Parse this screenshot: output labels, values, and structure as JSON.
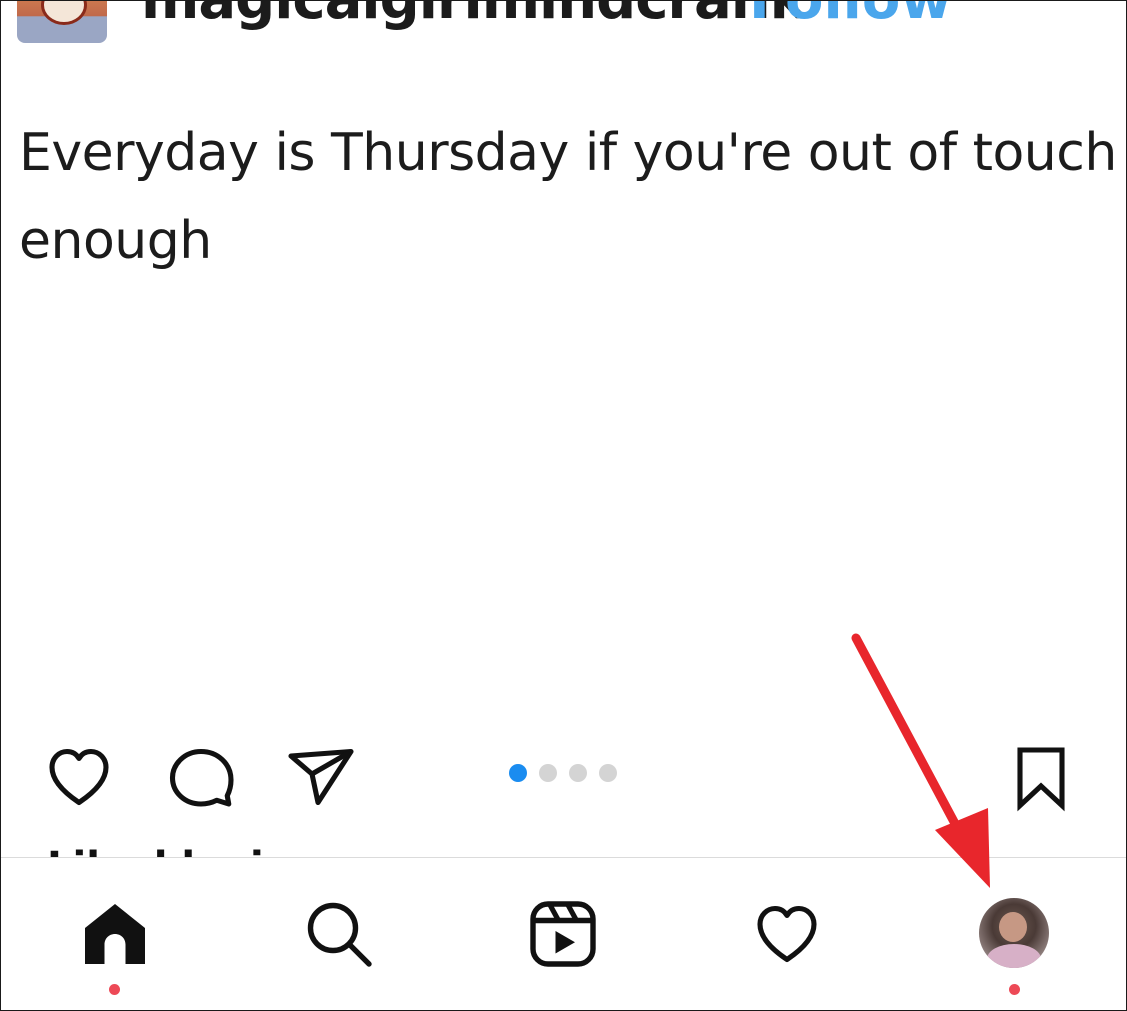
{
  "post": {
    "username": "magicalgirlmindcrank",
    "follow_label": "Follow",
    "text": "Everyday is Thursday if you're out of touch enough"
  },
  "actions": {
    "icons": [
      "heart-icon",
      "comment-icon",
      "share-icon",
      "bookmark-icon"
    ],
    "carousel": {
      "total": 4,
      "active_index": 0,
      "active_color": "#1a8cf0",
      "inactive_color": "#d4d4d4"
    }
  },
  "liked_by": "Liked by j",
  "bottom_nav": {
    "items": [
      "home-icon",
      "search-icon",
      "reels-icon",
      "activity-heart-icon",
      "profile-avatar"
    ],
    "notification_color": "#ed4956"
  },
  "annotation": {
    "color": "#e8262c",
    "target": "profile-avatar"
  }
}
